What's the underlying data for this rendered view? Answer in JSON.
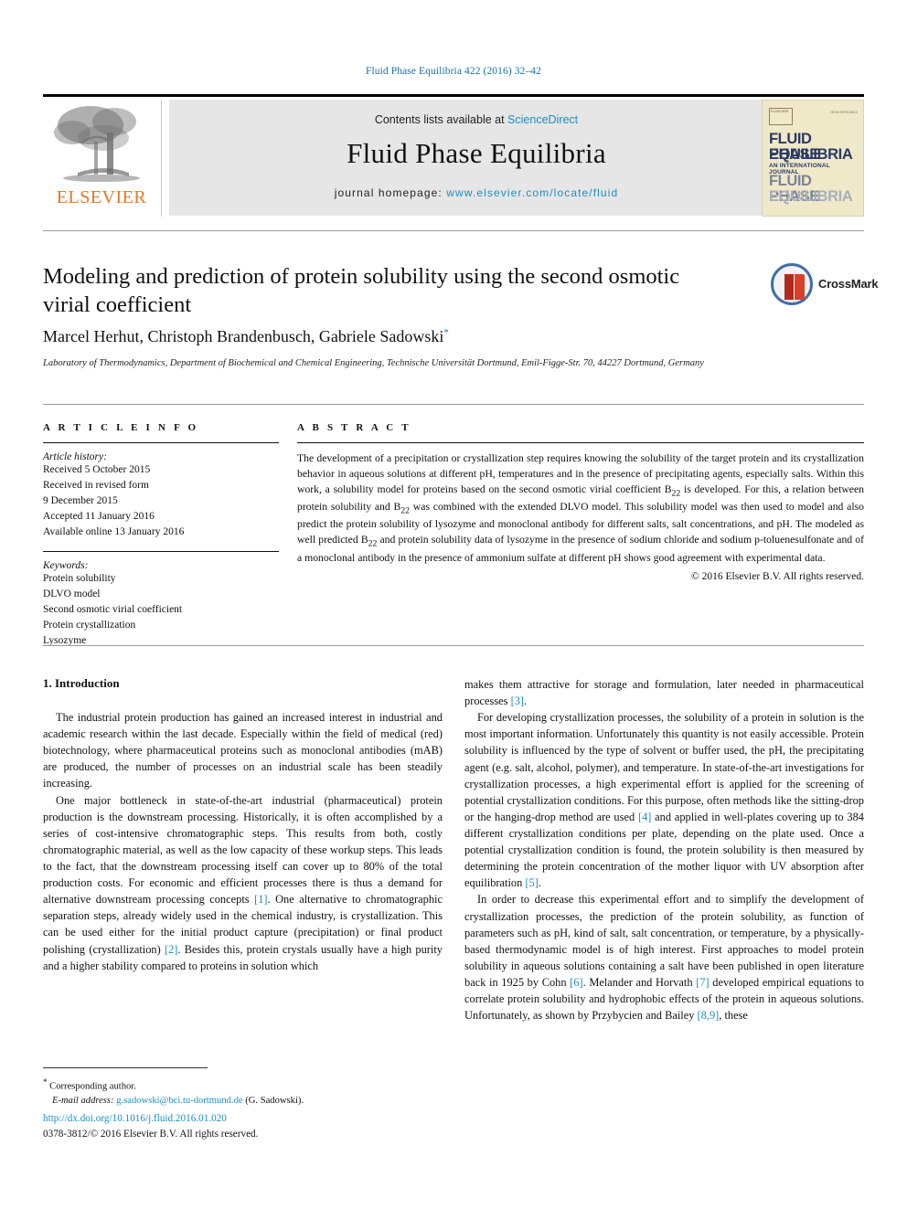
{
  "running_head": "Fluid Phase Equilibria 422 (2016) 32–42",
  "masthead": {
    "contents_prefix": "Contents lists available at ",
    "sciencedirect": "ScienceDirect",
    "journal_title": "Fluid Phase Equilibria",
    "homepage_prefix": "journal homepage: ",
    "homepage_url": "www.elsevier.com/locate/fluid",
    "publisher_logo_text": "ELSEVIER",
    "cover": {
      "elsevier_mark": "ELSEVIER",
      "issn_note": "ISSN 0378-3812",
      "line1": "FLUID PHASE",
      "line2": "EQUILIBRIA",
      "line3": "AN INTERNATIONAL JOURNAL",
      "line4": "FLUID PHASE",
      "line5": "EQUILIBRIA"
    }
  },
  "crossmark": {
    "label": "CrossMark"
  },
  "article": {
    "title": "Modeling and prediction of protein solubility using the second osmotic virial coefficient",
    "authors": "Marcel Herhut, Christoph Brandenbusch, Gabriele Sadowski",
    "corresponding_marker": "*",
    "affiliation": "Laboratory of Thermodynamics, Department of Biochemical and Chemical Engineering, Technische Universität Dortmund, Emil-Figge-Str. 70, 44227 Dortmund, Germany"
  },
  "article_info": {
    "heading": "A R T I C L E   I N F O",
    "history_label": "Article history:",
    "history": [
      "Received 5 October 2015",
      "Received in revised form",
      "9 December 2015",
      "Accepted 11 January 2016",
      "Available online 13 January 2016"
    ],
    "keywords_label": "Keywords:",
    "keywords": [
      "Protein solubility",
      "DLVO model",
      "Second osmotic virial coefficient",
      "Protein crystallization",
      "Lysozyme"
    ]
  },
  "abstract": {
    "heading": "A B S T R A C T",
    "paragraph_1": "The development of a precipitation or crystallization step requires knowing the solubility of the target protein and its crystallization behavior in aqueous solutions at different pH, temperatures and in the presence of precipitating agents, especially salts. Within this work, a solubility model for proteins based on the second osmotic virial coefficient B",
    "sub_1": "22",
    "paragraph_2": " is developed. For this, a relation between protein solubility and B",
    "sub_2": "22",
    "paragraph_3": " was combined with the extended DLVO model. This solubility model was then used to model and also predict the protein solubility of lysozyme and monoclonal antibody for different salts, salt concentrations, and pH. The modeled as well predicted B",
    "sub_3": "22",
    "paragraph_4": " and protein solubility data of lysozyme in the presence of sodium chloride and sodium p-toluenesulfonate and of a monoclonal antibody in the presence of ammonium sulfate at different pH shows good agreement with experimental data.",
    "copyright": "© 2016 Elsevier B.V. All rights reserved."
  },
  "body": {
    "section_heading": "1. Introduction",
    "left": {
      "p1": "The industrial protein production has gained an increased interest in industrial and academic research within the last decade. Especially within the field of medical (red) biotechnology, where pharmaceutical proteins such as monoclonal antibodies (mAB) are produced, the number of processes on an industrial scale has been steadily increasing.",
      "p2_a": "One major bottleneck in state-of-the-art industrial (pharmaceutical) protein production is the downstream processing. Historically, it is often accomplished by a series of cost-intensive chromatographic steps. This results from both, costly chromatographic material, as well as the low capacity of these workup steps. This leads to the fact, that the downstream processing itself can cover up to 80% of the total production costs. For economic and efficient processes there is thus a demand for alternative downstream processing concepts ",
      "p2_ref1": "[1]",
      "p2_b": ". One alternative to chromatographic separation steps, already widely used in the chemical industry, is crystallization. This can be used either for the initial product capture (precipitation) or final product polishing (crystallization) ",
      "p2_ref2": "[2]",
      "p2_c": ". Besides this, protein crystals usually have a high purity and a higher stability compared to proteins in solution which"
    },
    "right": {
      "p1_a": "makes them attractive for storage and formulation, later needed in pharmaceutical processes ",
      "p1_ref3": "[3]",
      "p1_b": ".",
      "p2_a": "For developing crystallization processes, the solubility of a protein in solution is the most important information. Unfortunately this quantity is not easily accessible. Protein solubility is influenced by the type of solvent or buffer used, the pH, the precipitating agent (e.g. salt, alcohol, polymer), and temperature. In state-of-the-art investigations for crystallization processes, a high experimental effort is applied for the screening of potential crystallization conditions. For this purpose, often methods like the sitting-drop or the hanging-drop method are used ",
      "p2_ref4": "[4]",
      "p2_b": " and applied in well-plates covering up to 384 different crystallization conditions per plate, depending on the plate used. Once a potential crystallization condition is found, the protein solubility is then measured by determining the protein concentration of the mother liquor with UV absorption after equilibration ",
      "p2_ref5": "[5]",
      "p2_c": ".",
      "p3_a": "In order to decrease this experimental effort and to simplify the development of crystallization processes, the prediction of the protein solubility, as function of parameters such as pH, kind of salt, salt concentration, or temperature, by a physically-based thermodynamic model is of high interest. First approaches to model protein solubility in aqueous solutions containing a salt have been published in open literature back in 1925 by Cohn ",
      "p3_ref6": "[6]",
      "p3_b": ". Melander and Horvath ",
      "p3_ref7": "[7]",
      "p3_c": " developed empirical equations to correlate protein solubility and hydrophobic effects of the protein in aqueous solutions. Unfortunately, as shown by Przybycien and Bailey ",
      "p3_ref8": "[8,9]",
      "p3_d": ", these"
    }
  },
  "footer": {
    "corresponding_note": "Corresponding author.",
    "email_label": "E-mail address:",
    "email": "g.sadowski@bci.tu-dortmund.de",
    "email_owner": "(G. Sadowski).",
    "doi": "http://dx.doi.org/10.1016/j.fluid.2016.01.020",
    "issn_line": "0378-3812/© 2016 Elsevier B.V. All rights reserved."
  },
  "colors": {
    "link": "#1a8ec4",
    "running_head": "#1a6fa8",
    "elsevier_orange": "#e87722",
    "band_gray": "#e6e6e6"
  }
}
